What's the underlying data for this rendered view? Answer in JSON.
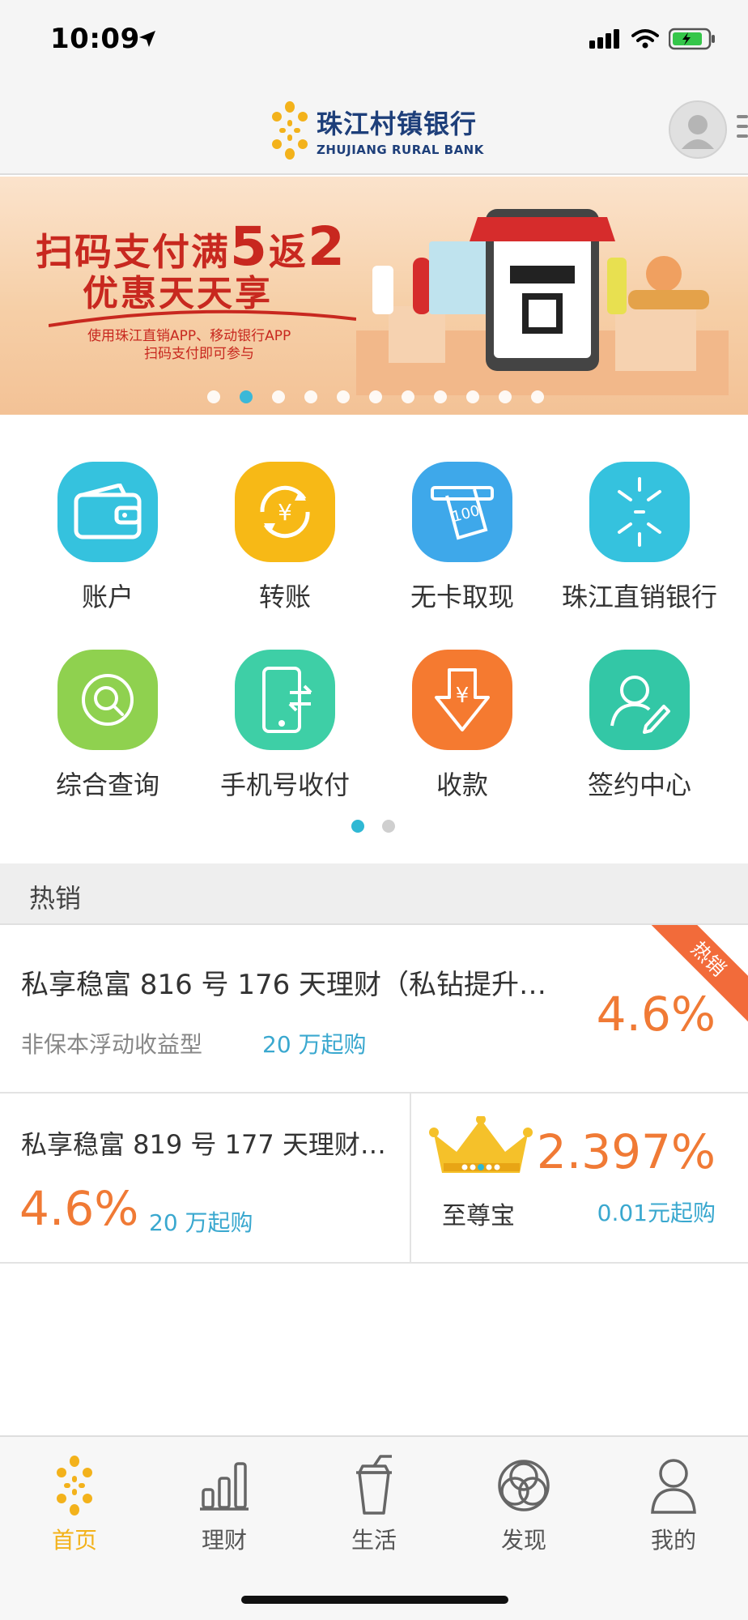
{
  "status_bar": {
    "time": "10:09"
  },
  "header": {
    "bank_name_cn": "珠江村镇银行",
    "bank_name_en": "ZHUJIANG RURAL BANK"
  },
  "banner": {
    "title_line1_a": "扫码支付满",
    "title_line1_num1": "5",
    "title_line1_b": "返",
    "title_line1_num2": "2",
    "title_line2": "优惠天天享",
    "sub_line1": "使用珠江直销APP、移动银行APP",
    "sub_line2": "扫码支付即可参与",
    "slide_count": 11,
    "active_slide": 1
  },
  "quick_actions": [
    {
      "label": "账户",
      "icon": "wallet-icon",
      "color": "#35c2de"
    },
    {
      "label": "转账",
      "icon": "transfer-yuan-icon",
      "color": "#f7b916"
    },
    {
      "label": "无卡取现",
      "icon": "cash-bill-icon",
      "color": "#3ea8ea"
    },
    {
      "label": "珠江直销银行",
      "icon": "zhujiang-logo-icon",
      "color": "#35c2de"
    },
    {
      "label": "综合查询",
      "icon": "search-icon",
      "color": "#8fd14f"
    },
    {
      "label": "手机号收付",
      "icon": "phone-transfer-icon",
      "color": "#3ecfa6"
    },
    {
      "label": "收款",
      "icon": "receive-yuan-icon",
      "color": "#f57a30"
    },
    {
      "label": "签约中心",
      "icon": "user-sign-icon",
      "color": "#33c7a6"
    }
  ],
  "grid_pages": {
    "count": 2,
    "active": 0
  },
  "hot": {
    "section_title": "热销",
    "badge": "热销",
    "product1": {
      "name": "私享稳富 816 号 176 天理财（私钻提升…",
      "type": "非保本浮动收益型",
      "min": "20 万起购",
      "rate": "4.6%"
    },
    "product2": {
      "name": "私享稳富 819 号 177 天理财…",
      "rate": "4.6%",
      "min": "20 万起购"
    },
    "product3": {
      "name": "至尊宝",
      "rate": "2.397%",
      "min": "0.01元起购"
    }
  },
  "tabbar": [
    {
      "label": "首页",
      "icon": "home-flower-icon",
      "active": true
    },
    {
      "label": "理财",
      "icon": "bar-chart-icon",
      "active": false
    },
    {
      "label": "生活",
      "icon": "drink-cup-icon",
      "active": false
    },
    {
      "label": "发现",
      "icon": "discover-circles-icon",
      "active": false
    },
    {
      "label": "我的",
      "icon": "user-icon",
      "active": false
    }
  ]
}
